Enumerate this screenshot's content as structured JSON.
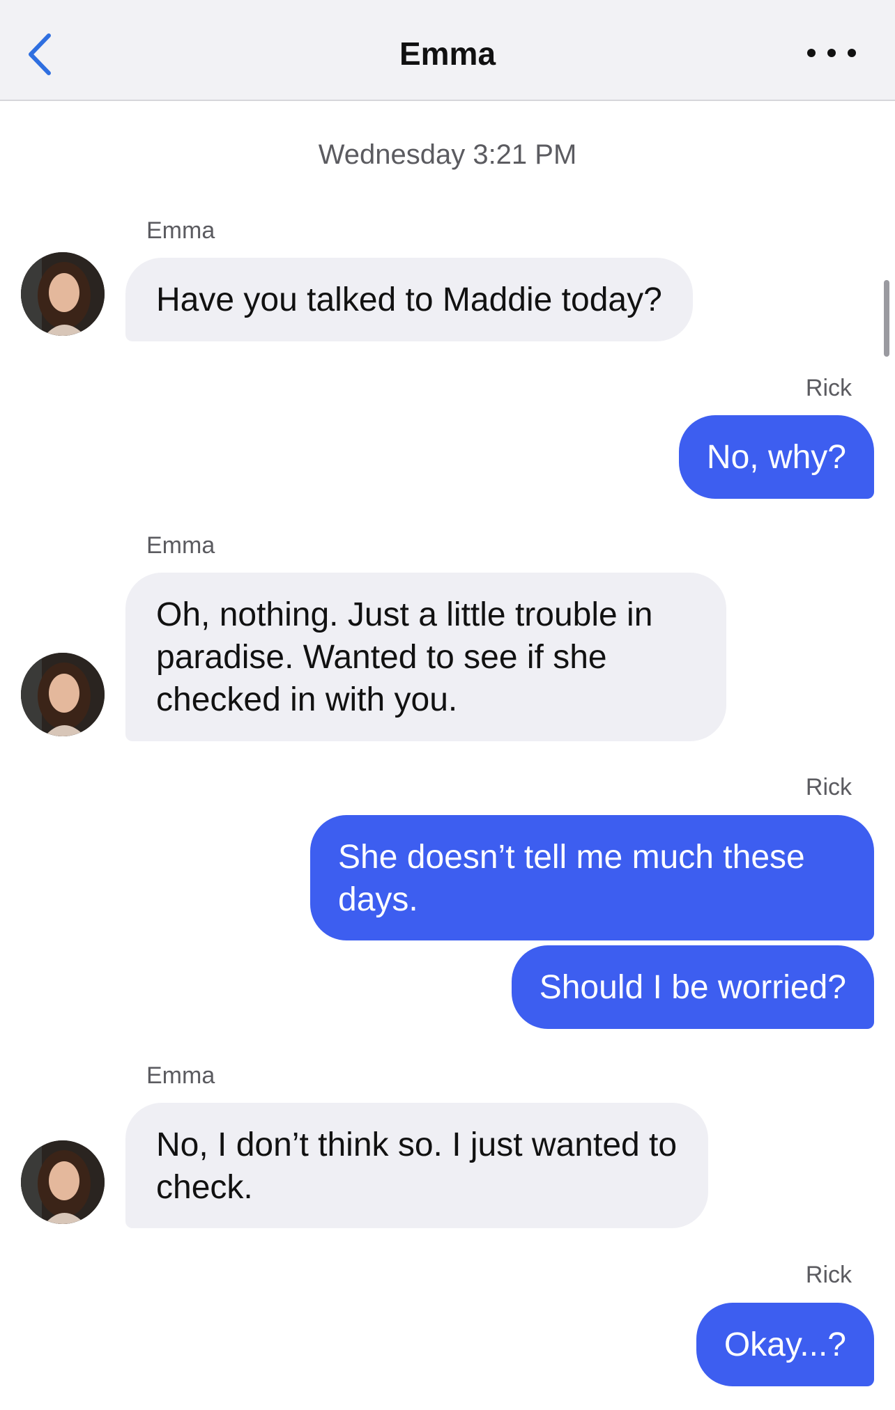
{
  "header": {
    "title": "Emma",
    "back_icon": "chevron-left-icon",
    "more_icon": "more-horizontal-icon",
    "accent_color": "#2f6fe0"
  },
  "conversation": {
    "timestamp": "Wednesday 3:21 PM",
    "messages": [
      {
        "sender": "Emma",
        "direction": "incoming",
        "text": "Have you talked to Maddie today?"
      },
      {
        "sender": "Rick",
        "direction": "outgoing",
        "text": "No, why?"
      },
      {
        "sender": "Emma",
        "direction": "incoming",
        "text": "Oh, nothing. Just a little trouble in paradise. Wanted to see if she checked in with you."
      },
      {
        "sender": "Rick",
        "direction": "outgoing",
        "text": "She doesn’t tell me much these days."
      },
      {
        "sender": "",
        "direction": "outgoing",
        "text": "Should I be worried?"
      },
      {
        "sender": "Emma",
        "direction": "incoming",
        "text": "No, I don’t think so. I just wanted to check."
      },
      {
        "sender": "Rick",
        "direction": "outgoing",
        "text": "Okay...?"
      }
    ]
  },
  "colors": {
    "outgoing_bubble": "#3d5ef0",
    "incoming_bubble": "#efeff4",
    "header_background": "#f2f2f5"
  }
}
